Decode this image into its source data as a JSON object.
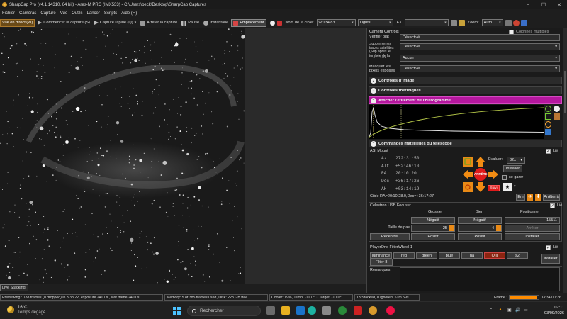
{
  "window": {
    "title": "SharpCap Pro (v4.1.14310, 64 bit) - Ares-M PRO (IMX533) - C:\\Users\\beck\\Desktop\\SharpCap Captures"
  },
  "menu": [
    "Fichier",
    "Caméras",
    "Capture",
    "Vue",
    "Outils",
    "Lancer",
    "Scripts",
    "Aide (H)"
  ],
  "toolbar": {
    "live_view": "Vue en direct (W)",
    "start_capture": "Commencer la capture (S)",
    "quick_capture": "Capture rapide (Q)",
    "stop_capture": "Arrêter la capture",
    "pause": "Pause",
    "snapshot": "Instantané",
    "framing": "Emplacement",
    "target_label": "Nom de la cible:",
    "target_value": "wr134 c3",
    "frame_type": "Lights",
    "fx_label": "FX",
    "fx_value": "",
    "zoom_label": "Zoom:",
    "zoom_value": "Auto"
  },
  "panel": {
    "header": "Camera Controls",
    "multi_columns": "Colonnes multiples",
    "rows": [
      {
        "label": "Vérifier plat",
        "value": "Désactivé"
      },
      {
        "label": "Supprimer les traces satellites (Sup après le tombée de la nuité-côté)",
        "value": "Désactivé"
      },
      {
        "label": "",
        "value": "Aucun"
      },
      {
        "label": "Masquer les pixels exposés",
        "value": "Désactivé"
      }
    ],
    "sections": {
      "image_controls": "Contrôles d'image",
      "thermal_controls": "Contrôles thermiques",
      "histogram": "Afficher l'étirement de l'histogramme",
      "telescope": "Commandes matérielles du télescope"
    },
    "mount": {
      "name": "ASI Mount",
      "linked_label": "Lié",
      "coords": [
        {
          "label": "Az",
          "value": "272:31:50"
        },
        {
          "label": "Alt",
          "value": "+52:46:10"
        },
        {
          "label": "RA",
          "value": "20:10:20"
        },
        {
          "label": "Déc",
          "value": "+36:17:26"
        },
        {
          "label": "AH",
          "value": "+03:14:19"
        }
      ],
      "eval_label": "Évaluer:",
      "speed": "32x",
      "install": "Installer",
      "manage_label": "se garer",
      "stop_center": "ARRÊTE",
      "stop_side": "Suivi",
      "target_line": "Cible RA=20:10:28.0,Dec=+36:17:27",
      "goto": "Em",
      "stop_short": "Arrêter à"
    },
    "focuser": {
      "name": "Celestron USB Focuser",
      "linked_label": "Lié",
      "col_coarse": "Grossier",
      "col_fine": "Bien",
      "col_position": "Positionner",
      "negative": "Négatif",
      "positive": "Positif",
      "step_label": "Taille de pas",
      "coarse_step": "25",
      "fine_step": "4",
      "position": "15511",
      "stop": "Arrêter",
      "recenter": "Recentrer",
      "install": "Installer"
    },
    "filterwheel": {
      "name": "PlayerOne FilterWheel 1",
      "linked_label": "Lié",
      "filters": [
        "luminance",
        "red",
        "green",
        "blue",
        "ha",
        "OIII",
        "s2"
      ],
      "active": "OIII",
      "extra": "Filter 8",
      "install": "Installer"
    },
    "remarks_label": "Remarques"
  },
  "status": {
    "live_stacking": "Live Stacking",
    "previewing": "Previewing : 188 frames (0 dropped) in 3:38:22, exposure 240.0s , last frame 240.0s",
    "memory": "Memory: 5 of 385 frames used, Disk: 223 GB free",
    "cooler": "Cooler: 19%, Temp: -10.0°C, Target: -10.0°",
    "stacked": "13 Stacked, 0 Ignored, 51m 59s",
    "frame_label": "Frame :",
    "frame_progress": 0.93,
    "frame_time": "03:34/00:26"
  },
  "taskbar": {
    "weather_temp": "16°C",
    "weather_desc": "Temps dégagé",
    "search": "Rechercher",
    "time": "02:11",
    "date": "03/09/2026"
  },
  "colors": {
    "accent": "#ff8c00",
    "histogram_header": "#b5179e",
    "stop_button": "#e11b1b"
  }
}
